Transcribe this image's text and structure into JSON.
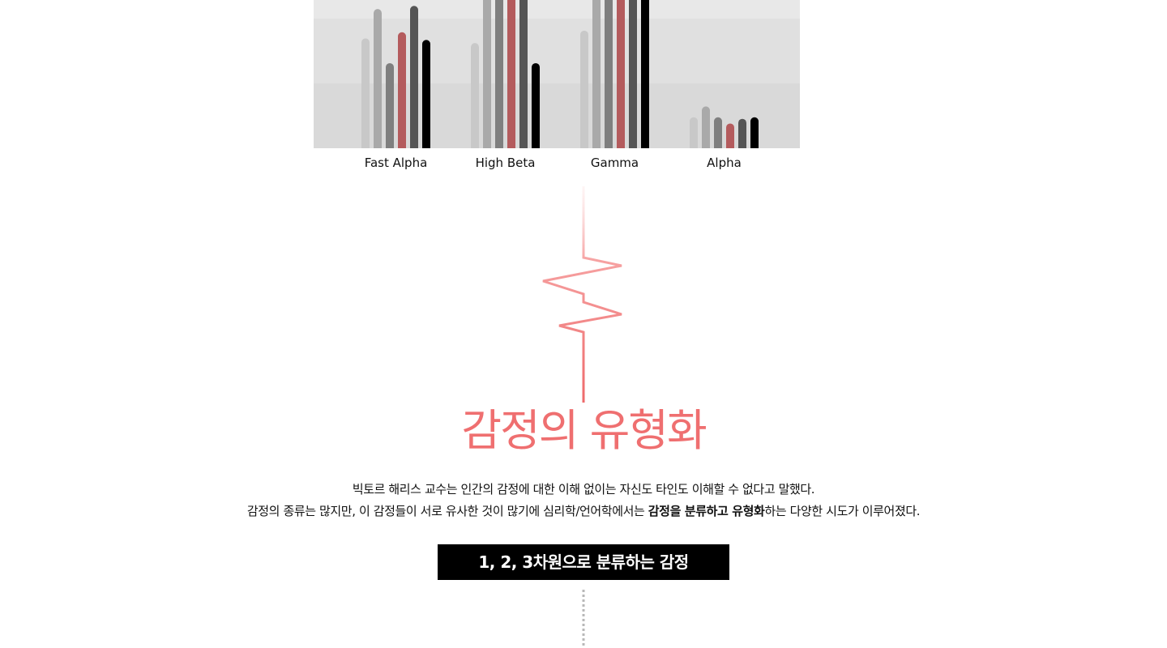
{
  "chart_data": {
    "type": "bar",
    "categories": [
      "Fast Alpha",
      "High Beta",
      "Gamma",
      "Alpha"
    ],
    "ylim": [
      0,
      100
    ],
    "grid": false,
    "series": [
      {
        "values": [
          71,
          68,
          76,
          20
        ]
      },
      {
        "values": [
          90,
          100,
          100,
          27
        ]
      },
      {
        "values": [
          55,
          100,
          100,
          20
        ]
      },
      {
        "values": [
          75,
          100,
          100,
          16
        ]
      },
      {
        "values": [
          92,
          99,
          100,
          19
        ]
      },
      {
        "values": [
          70,
          55,
          100,
          20
        ]
      }
    ],
    "colors": {
      "series": [
        "#c8c8c8",
        "#a9a9a9",
        "#7f7f7f",
        "#b45b5d",
        "#555555",
        "#000000"
      ],
      "bands": [
        "#e8e8e8",
        "#e0e0e0",
        "#d9d9d9"
      ],
      "pulse_top": "#fde6e6",
      "pulse_mid": "#f6a0a0",
      "pulse_bottom": "#ee6a6b"
    }
  },
  "section": {
    "title": "감정의 유형화",
    "desc_line1": "빅토르 해리스 교수는 인간의 감정에 대한 이해 없이는 자신도 타인도 이해할 수 없다고 말했다.",
    "desc_line2_before": "감정의 종류는 많지만, 이 감정들이 서로 유사한 것이 많기에 심리학/언어학에서는 ",
    "desc_line2_bold": "감정을 분류하고 유형화",
    "desc_line2_after": "하는 다양한 시도가 이루어졌다.",
    "banner_label": "1, 2, 3차원으로 분류하는 감정"
  }
}
